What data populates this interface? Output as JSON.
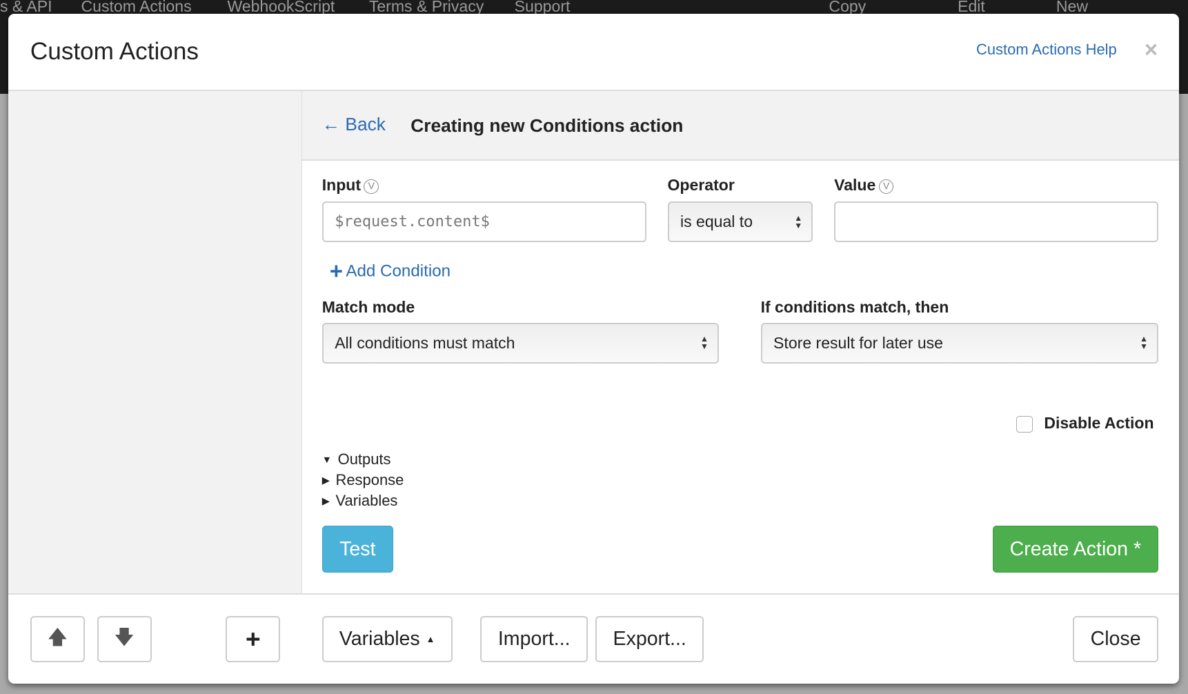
{
  "topnav": [
    "s & API",
    "Custom Actions",
    "WebhookScript",
    "Terms & Privacy",
    "Support",
    "Copy",
    "Edit",
    "New"
  ],
  "modal": {
    "title": "Custom Actions",
    "help_link": "Custom Actions Help",
    "close_icon": "×"
  },
  "editor": {
    "back": "← Back",
    "title": "Creating new Conditions action",
    "input_label": "Input",
    "operator_label": "Operator",
    "value_label": "Value",
    "var_icon": "V",
    "input_value": "$request.content$",
    "operator_value": "is equal to",
    "value_value": "",
    "add_condition": "Add Condition",
    "match_mode_label": "Match mode",
    "match_mode_value": "All conditions must match",
    "then_label": "If conditions match, then",
    "then_value": "Store result for later use",
    "disable_label": "Disable Action",
    "disable_checked": false,
    "tree": [
      "Outputs",
      "Response",
      "Variables"
    ],
    "test": "Test",
    "create": "Create Action *"
  },
  "footer": {
    "variables": "Variables",
    "import": "Import...",
    "export": "Export...",
    "close": "Close"
  },
  "colors": {
    "link": "#2a6ab2",
    "test": "#4bb3d9",
    "create": "#4cae4c"
  }
}
